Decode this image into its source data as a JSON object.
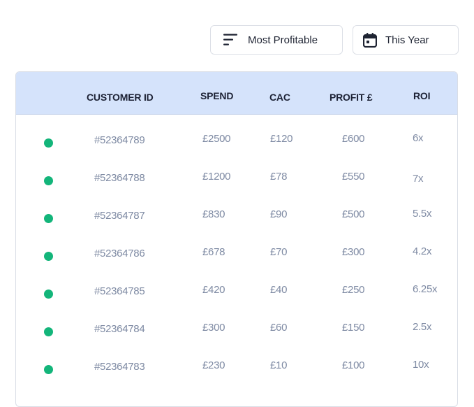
{
  "filters": {
    "sort_label": "Most Profitable",
    "sort_icon": "sort-lines-icon",
    "date_label": "This Year",
    "date_icon": "calendar-icon"
  },
  "table": {
    "columns": [
      "CUSTOMER ID",
      "SPEND",
      "CAC",
      "PROFIT £",
      "ROI"
    ],
    "status_color": "#13b57a",
    "header_bg": "#d5e3fb",
    "rows": [
      {
        "customer_id": "#52364789",
        "spend": "£2500",
        "cac": "£120",
        "profit": "£600",
        "roi": "6x"
      },
      {
        "customer_id": "#52364788",
        "spend": "£1200",
        "cac": "£78",
        "profit": "£550",
        "roi": "7x"
      },
      {
        "customer_id": "#52364787",
        "spend": "£830",
        "cac": "£90",
        "profit": "£500",
        "roi": "5.5x"
      },
      {
        "customer_id": "#52364786",
        "spend": "£678",
        "cac": "£70",
        "profit": "£300",
        "roi": "4.2x"
      },
      {
        "customer_id": "#52364785",
        "spend": "£420",
        "cac": "£40",
        "profit": "£250",
        "roi": "6.25x"
      },
      {
        "customer_id": "#52364784",
        "spend": "£300",
        "cac": "£60",
        "profit": "£150",
        "roi": "2.5x"
      },
      {
        "customer_id": "#52364783",
        "spend": "£230",
        "cac": "£10",
        "profit": "£100",
        "roi": "10x"
      }
    ]
  }
}
